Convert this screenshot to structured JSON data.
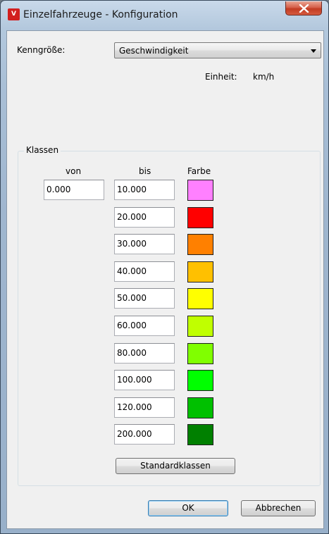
{
  "window": {
    "title": "Einzelfahrzeuge - Konfiguration",
    "icon": "app-icon",
    "close_glyph": "✕"
  },
  "form": {
    "kenngroesse_label": "Kenngröße:",
    "kenngroesse_value": "Geschwindigkeit",
    "einheit_label": "Einheit:",
    "einheit_value": "km/h"
  },
  "klassen": {
    "title": "Klassen",
    "headers": {
      "von": "von",
      "bis": "bis",
      "farbe": "Farbe"
    },
    "von_first": "0.000",
    "rows": [
      {
        "bis": "10.000",
        "color": "#ff80ff"
      },
      {
        "bis": "20.000",
        "color": "#ff0000"
      },
      {
        "bis": "30.000",
        "color": "#ff8000"
      },
      {
        "bis": "40.000",
        "color": "#ffc000"
      },
      {
        "bis": "50.000",
        "color": "#ffff00"
      },
      {
        "bis": "60.000",
        "color": "#c0ff00"
      },
      {
        "bis": "80.000",
        "color": "#80ff00"
      },
      {
        "bis": "100.000",
        "color": "#00ff00"
      },
      {
        "bis": "120.000",
        "color": "#00c000"
      },
      {
        "bis": "200.000",
        "color": "#008000"
      }
    ],
    "standard_button": "Standardklassen"
  },
  "buttons": {
    "ok": "OK",
    "cancel": "Abbrechen"
  }
}
